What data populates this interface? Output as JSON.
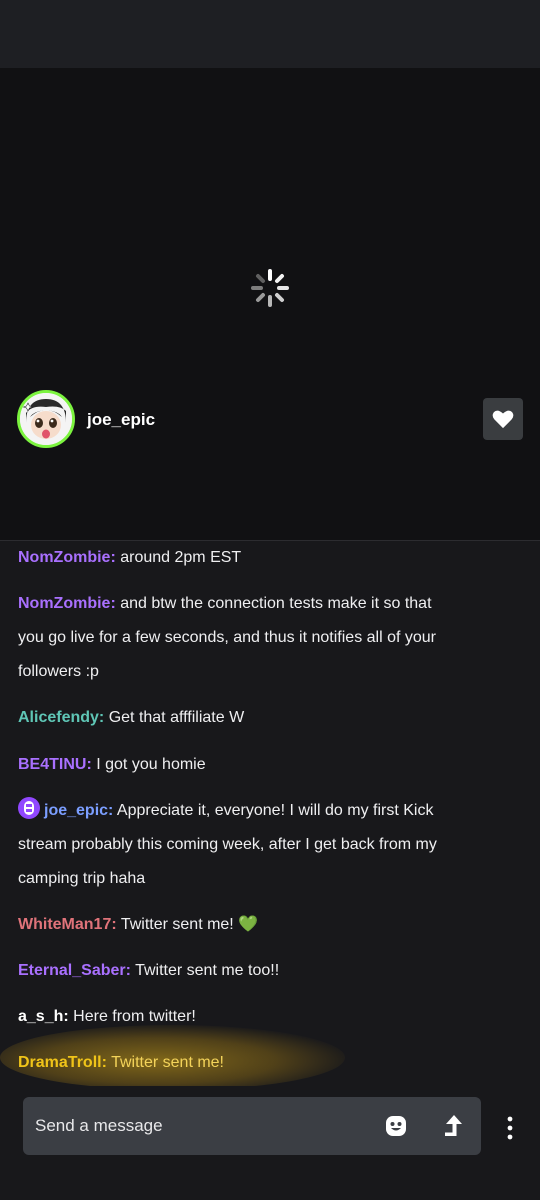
{
  "channel": {
    "name": "joe_epic",
    "follow_icon": "heart-icon"
  },
  "chat": {
    "messages": [
      {
        "user": "NomZombie:",
        "color": "#a970ff",
        "lines": [
          "around 2pm EST"
        ]
      },
      {
        "user": "NomZombie:",
        "color": "#a970ff",
        "lines": [
          "and btw the connection tests make it so that",
          "you go live for a few seconds, and thus it notifies all of your",
          "followers :p"
        ]
      },
      {
        "user": "Alicefendy:",
        "color": "#5fc6b6",
        "lines": [
          "Get that afffiliate W"
        ]
      },
      {
        "user": "BE4TINU:",
        "color": "#a970ff",
        "lines": [
          "I got you homie"
        ]
      },
      {
        "user": "joe_epic:",
        "color": "#7b9eff",
        "badge": "broadcaster-badge-icon",
        "lines": [
          "Appreciate it, everyone! I will do my first Kick",
          "stream probably this coming week, after I get back from my",
          "camping trip haha"
        ]
      },
      {
        "user": "WhiteMan17:",
        "color": "#e0737a",
        "lines": [
          "Twitter sent me! 💚"
        ]
      },
      {
        "user": "Eternal_Saber:",
        "color": "#a970ff",
        "lines": [
          "Twitter sent me too!!"
        ]
      },
      {
        "user": "a_s_h:",
        "color": "#ffffff",
        "lines": [
          "Here from twitter!"
        ]
      },
      {
        "user": "DramaTroll:",
        "color": "#f0c419",
        "lines": [
          "Twitter sent me!"
        ]
      }
    ]
  },
  "input": {
    "placeholder": "Send a message",
    "emote_icon": "smiley-icon",
    "send_icon": "send-arrow-icon"
  },
  "more_icon": "kebab-menu-icon"
}
